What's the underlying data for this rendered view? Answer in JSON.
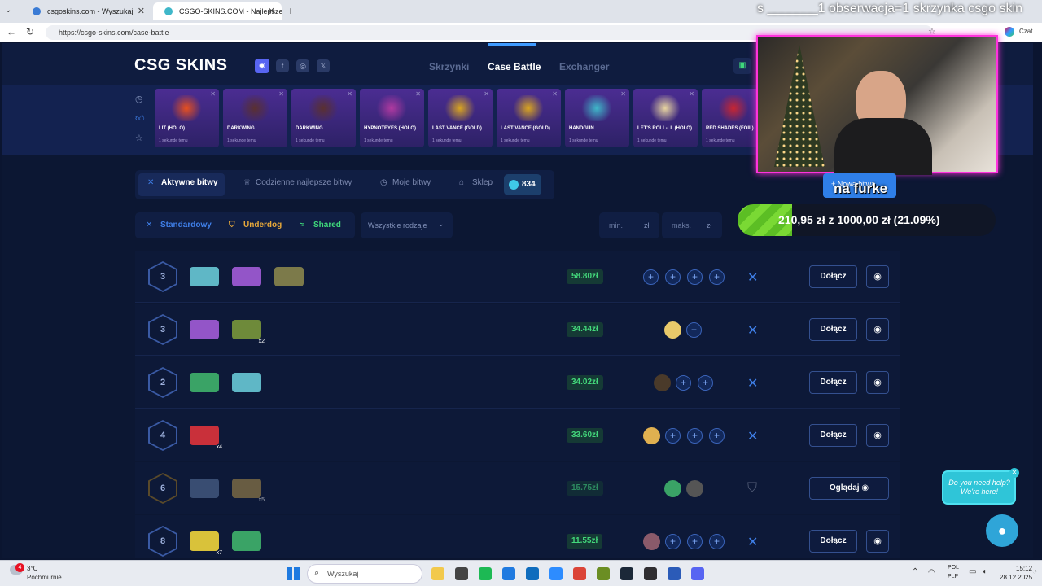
{
  "browser": {
    "tabs": [
      {
        "title": "csgoskins.com - Wyszukaj"
      },
      {
        "title": "CSGO-SKINS.COM - Najlepsze Skr"
      }
    ],
    "url": "https://csgo-skins.com/case-battle",
    "chat_label": "Czat"
  },
  "overlay": {
    "ticker": "s _______1 obserwacja=1 skrzynka csgo skin",
    "caption": "na furke",
    "goal_text": "210,95 zł z 1000,00 zł (21.09%)",
    "goal_fraction": 0.2109
  },
  "site": {
    "logo": "CSG SKINS",
    "nav": [
      "Skrzynki",
      "Case Battle",
      "Exchanger"
    ],
    "drops": [
      {
        "name": "LIT (HOLO)",
        "time": "1 sekundę temu",
        "color": "#e8501e"
      },
      {
        "name": "DARKWING",
        "time": "1 sekundę temu",
        "color": "#5a3030"
      },
      {
        "name": "DARKWING",
        "time": "1 sekundę temu",
        "color": "#5a3030"
      },
      {
        "name": "HYPNOTEYES (HOLO)",
        "time": "1 sekundę temu",
        "color": "#b03aa0"
      },
      {
        "name": "LAST VANCE (GOLD)",
        "time": "1 sekundę temu",
        "color": "#d9a520"
      },
      {
        "name": "LAST VANCE (GOLD)",
        "time": "1 sekundę temu",
        "color": "#d9a520"
      },
      {
        "name": "HANDGUN",
        "time": "1 sekundę temu",
        "color": "#3fb7c9"
      },
      {
        "name": "LET'S ROLL-LL (HOLO)",
        "time": "1 sekundę temu",
        "color": "#e8d5a0"
      },
      {
        "name": "RED SHADES (FOIL)",
        "time": "1 sekundę temu",
        "color": "#c72632"
      }
    ],
    "tabs": [
      "Aktywne bitwy",
      "Codzienne najlepsze bitwy",
      "Moje bitwy",
      "Sklep"
    ],
    "coins": "834",
    "filters": [
      "Standardowy",
      "Underdog",
      "Shared"
    ],
    "mode_select": "Wszystkie rodzaje",
    "min_placeholder": "min.",
    "max_placeholder": "maks.",
    "currency": "zł",
    "new_battle": "+ Nowa bitwa",
    "battles": [
      {
        "rounds": "3",
        "price": "58.80zł",
        "action": "Dołącz",
        "cases": [
          {
            "color": "#5fb7c6",
            "mult": ""
          },
          {
            "color": "#9355c8",
            "mult": ""
          },
          {
            "color": "#7c7a4a",
            "mult": ""
          }
        ],
        "avatars": [],
        "slots": 4
      },
      {
        "rounds": "3",
        "price": "34.44zł",
        "action": "Dołącz",
        "cases": [
          {
            "color": "#9355c8",
            "mult": ""
          },
          {
            "color": "#6e8a3a",
            "mult": "x2"
          }
        ],
        "avatars": [
          "#e8c96a"
        ],
        "slots": 1
      },
      {
        "rounds": "2",
        "price": "34.02zł",
        "action": "Dołącz",
        "cases": [
          {
            "color": "#3aa366",
            "mult": ""
          },
          {
            "color": "#5fb7c6",
            "mult": ""
          }
        ],
        "avatars": [
          "#4a3a2a"
        ],
        "slots": 2
      },
      {
        "rounds": "4",
        "price": "33.60zł",
        "action": "Dołącz",
        "cases": [
          {
            "color": "#c9303a",
            "mult": "x4"
          }
        ],
        "avatars": [
          "#e0b050"
        ],
        "slots": 3
      },
      {
        "rounds": "6",
        "price": "15.75zł",
        "action": "Oglądaj",
        "cases": [
          {
            "color": "#56709a",
            "mult": ""
          },
          {
            "color": "#a58a4a",
            "mult": "x5"
          }
        ],
        "avatars": [
          "#3aa366",
          "#555555"
        ],
        "slots": 0
      },
      {
        "rounds": "8",
        "price": "11.55zł",
        "action": "Dołącz",
        "cases": [
          {
            "color": "#d9c23a",
            "mult": "x7"
          },
          {
            "color": "#3aa366",
            "mult": ""
          }
        ],
        "avatars": [
          "#8a5a6a"
        ],
        "slots": 3
      }
    ]
  },
  "chat_widget": {
    "text": "Do you need help? We're here!"
  },
  "taskbar": {
    "weather_temp": "3°C",
    "weather_text": "Pochmurnie",
    "weather_badge": "4",
    "search_placeholder": "Wyszukaj",
    "lang_line1": "POL",
    "lang_line2": "PLP",
    "time": "15:12",
    "date": "28.12.2025"
  }
}
